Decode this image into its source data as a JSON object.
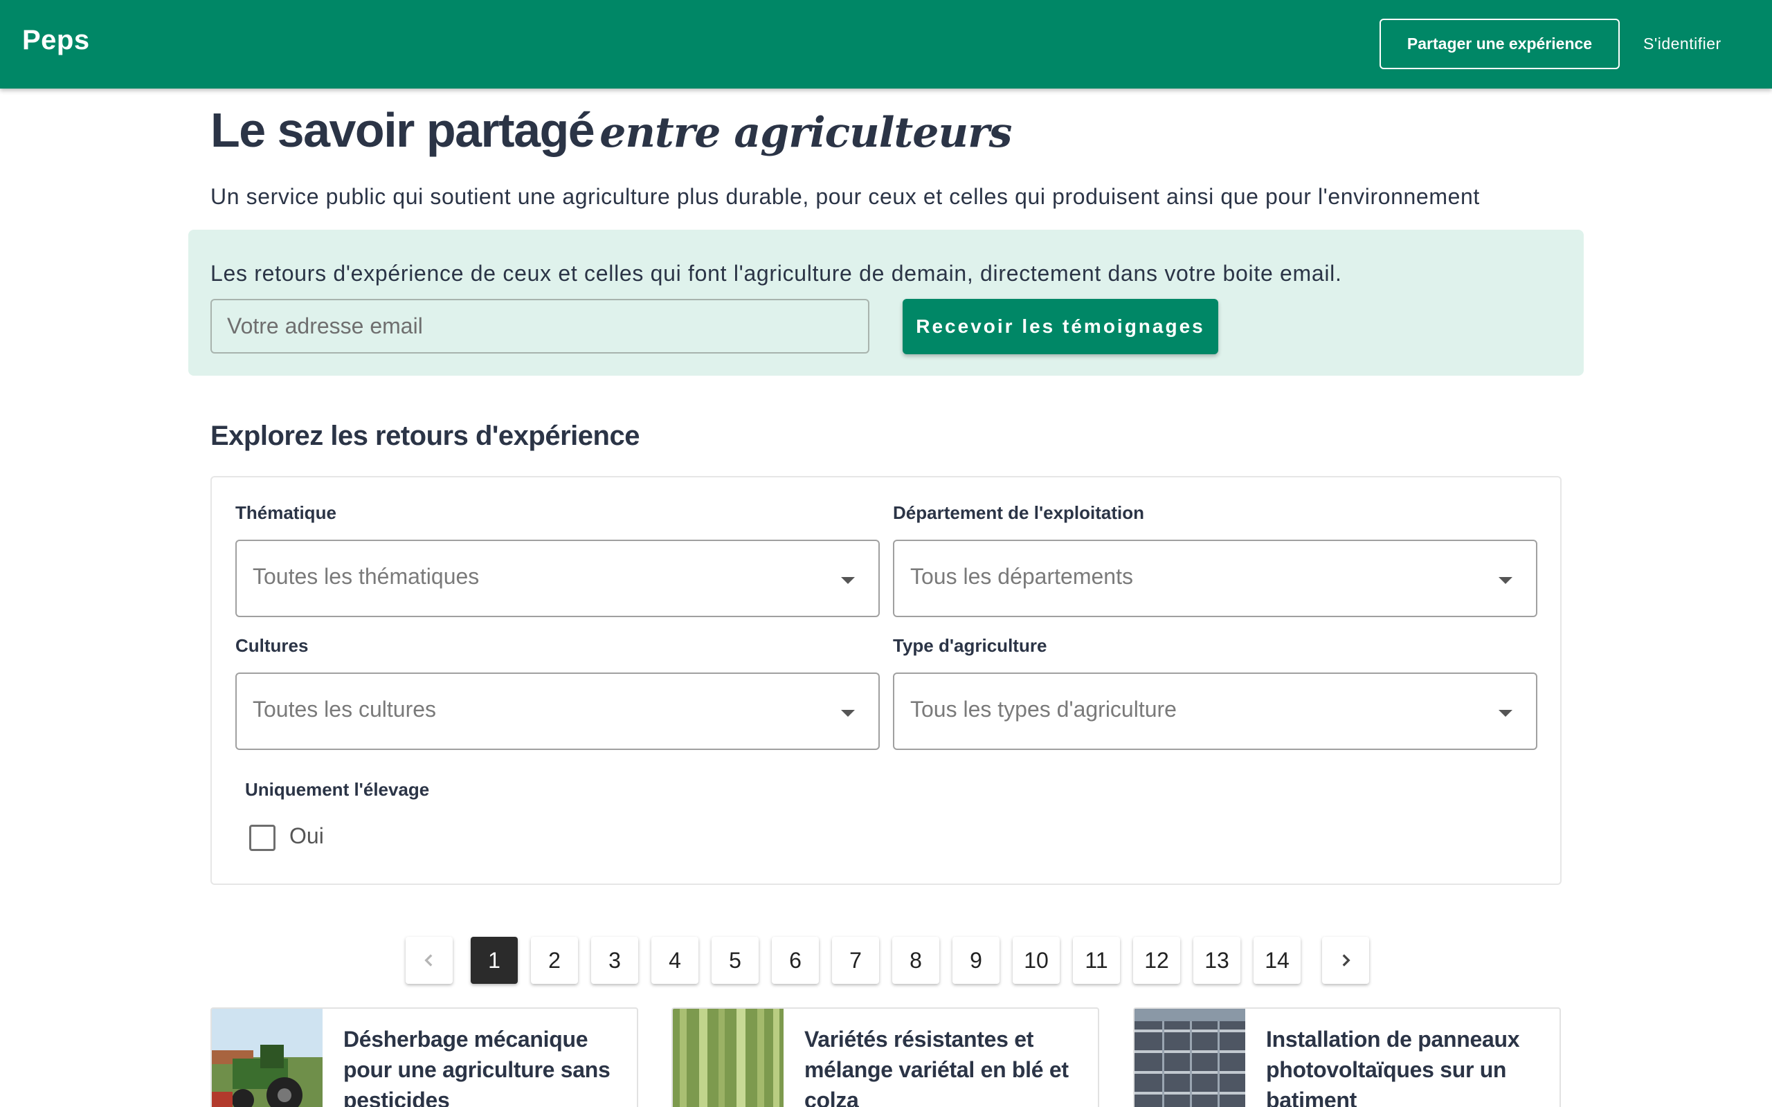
{
  "header": {
    "brand": "Peps",
    "share_label": "Partager une expérience",
    "login_label": "S'identifier",
    "bg_color": "#008766"
  },
  "hero": {
    "title_main": "Le savoir partagé",
    "title_script": "entre agriculteurs",
    "subtitle": "Un service public qui soutient une agriculture plus durable, pour ceux et celles qui produisent ainsi que pour l'environnement"
  },
  "newsletter": {
    "text": "Les retours d'expérience de ceux et celles qui font l'agriculture de demain, directement dans votre boite email.",
    "email_placeholder": "Votre adresse email",
    "email_value": "",
    "button_label": "Recevoir les témoignages",
    "bg_color": "#dff2ec"
  },
  "explore": {
    "title": "Explorez les retours d'expérience",
    "filters": {
      "thematique": {
        "label": "Thématique",
        "placeholder": "Toutes les thématiques"
      },
      "departement": {
        "label": "Département de l'exploitation",
        "placeholder": "Tous les départements"
      },
      "cultures": {
        "label": "Cultures",
        "placeholder": "Toutes les cultures"
      },
      "type": {
        "label": "Type d'agriculture",
        "placeholder": "Tous les types d'agriculture"
      },
      "elevage": {
        "label": "Uniquement l'élevage",
        "option": "Oui",
        "checked": false
      }
    }
  },
  "pagination": {
    "prev_icon": "chevron-left-icon",
    "next_icon": "chevron-right-icon",
    "pages": [
      "1",
      "2",
      "3",
      "4",
      "5",
      "6",
      "7",
      "8",
      "9",
      "10",
      "11",
      "12",
      "13",
      "14"
    ],
    "current": "1"
  },
  "cards": [
    {
      "title": "Désherbage mécanique pour une agriculture sans pesticides",
      "image": "tractor-photo"
    },
    {
      "title": "Variétés résistantes et mélange variétal en blé et colza",
      "image": "wheat-photo"
    },
    {
      "title": "Installation de panneaux photovoltaïques sur un batiment",
      "image": "solar-panels-photo"
    }
  ]
}
